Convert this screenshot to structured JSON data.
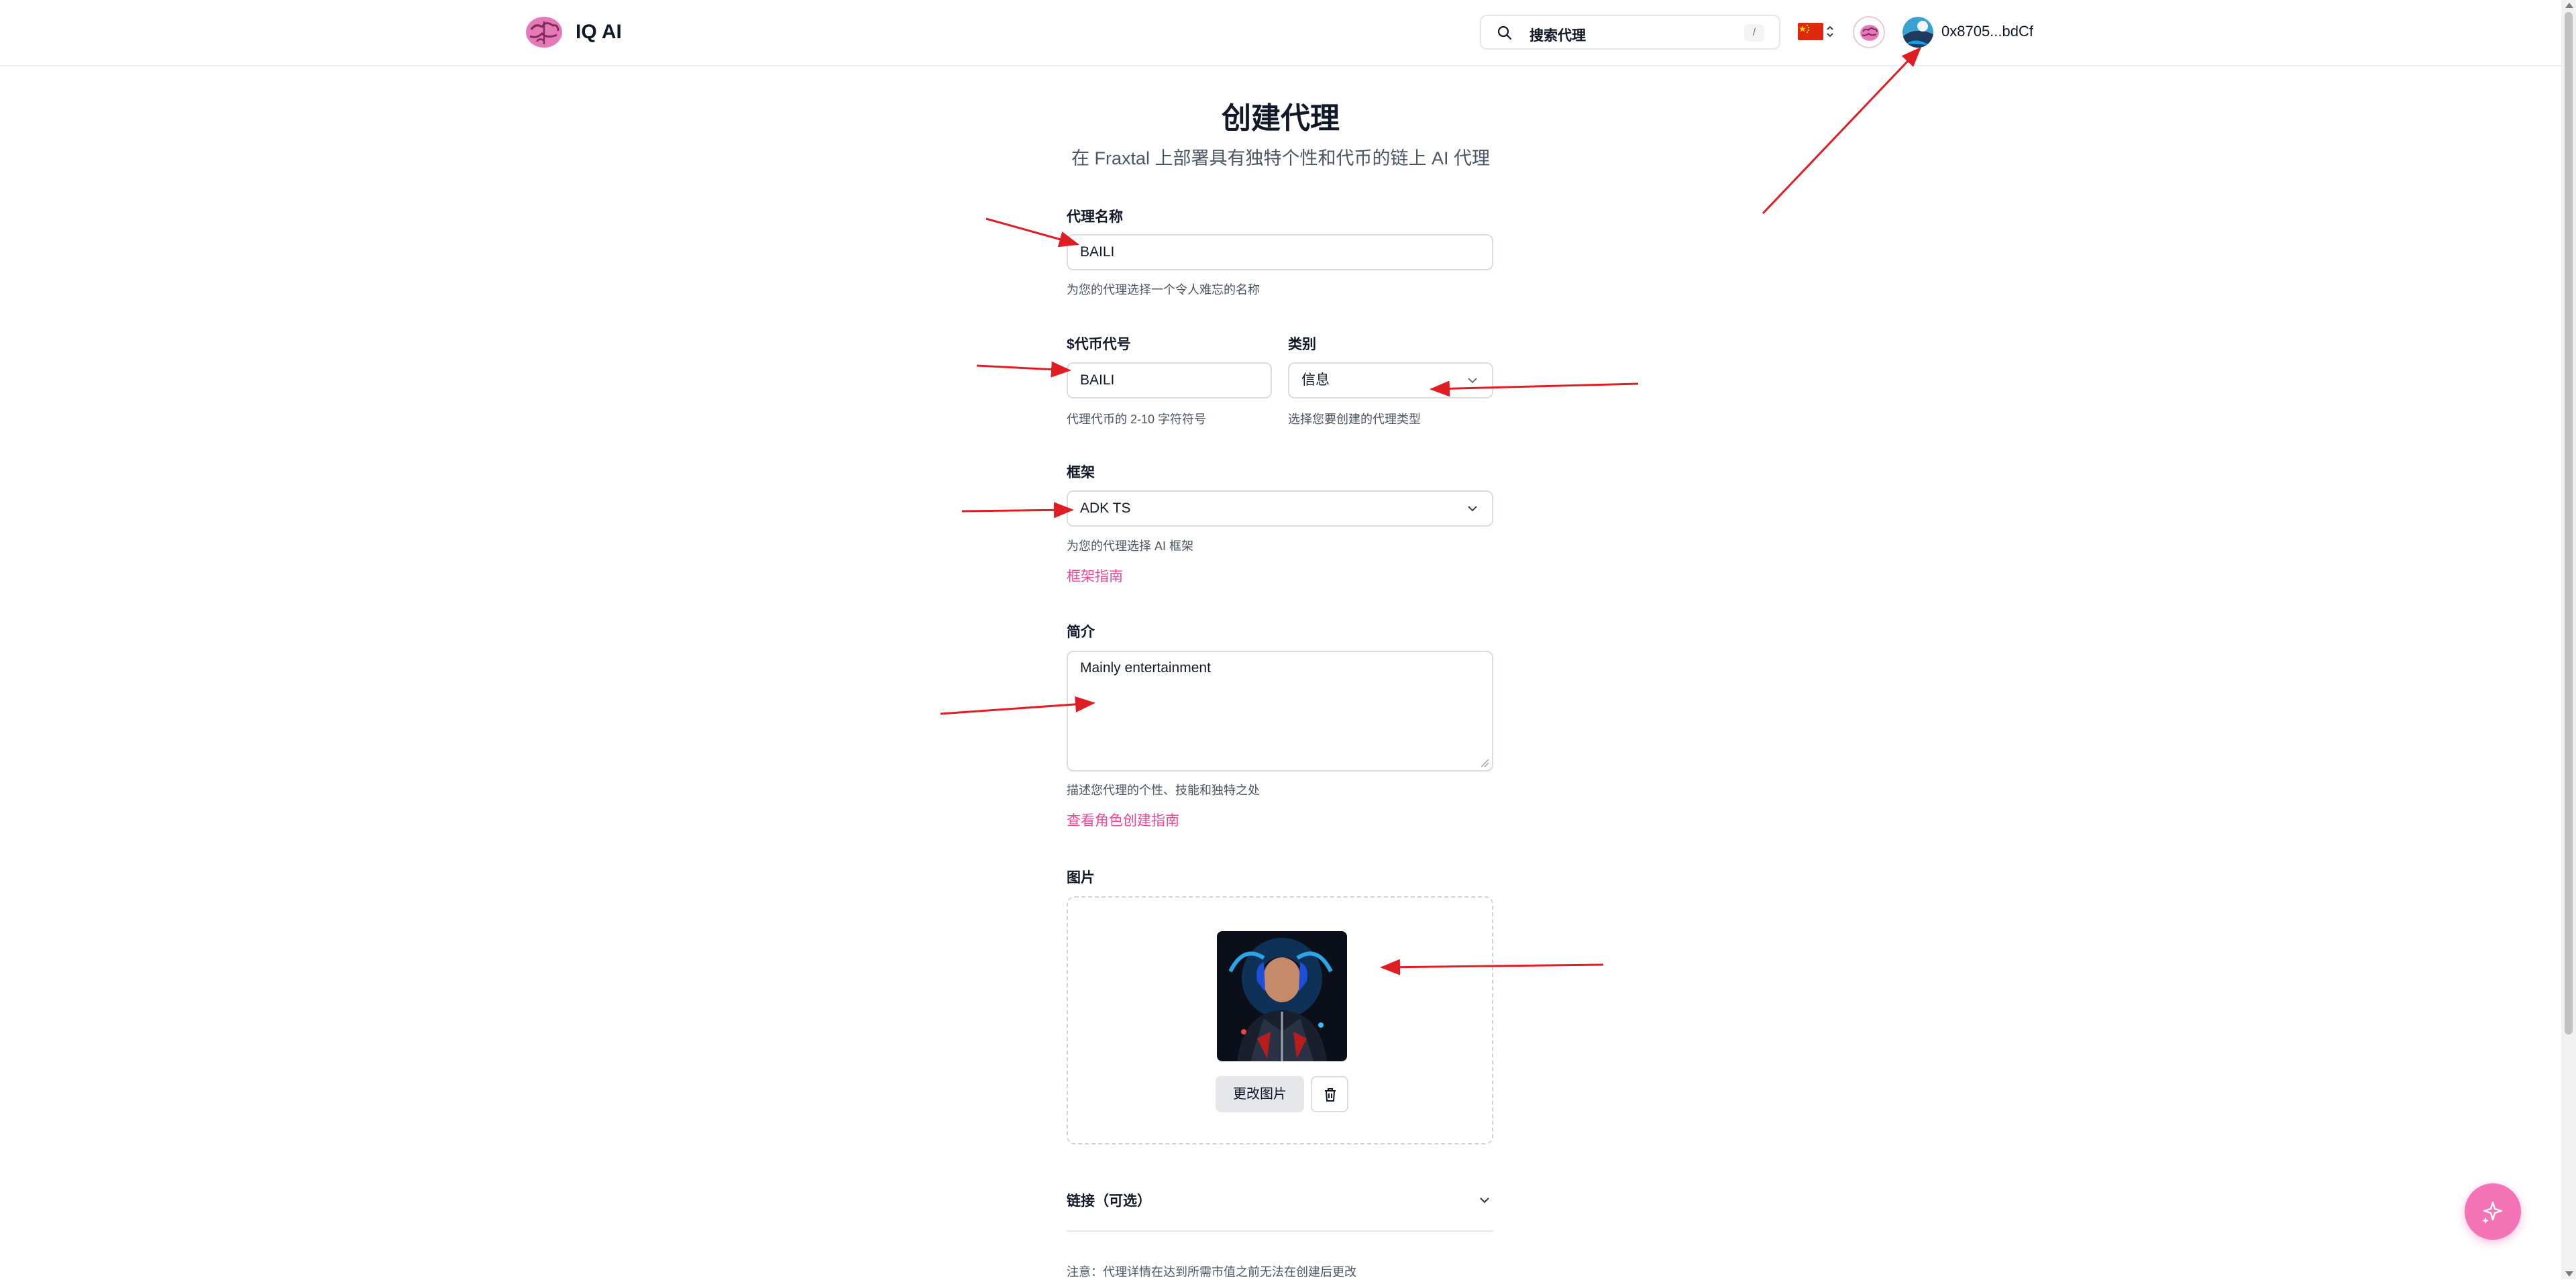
{
  "header": {
    "brand": "IQ AI",
    "search_placeholder": "搜索代理",
    "search_shortcut": "/",
    "language": "CN",
    "wallet_address": "0x8705...bdCf"
  },
  "page": {
    "title": "创建代理",
    "subtitle": "在 Fraxtal 上部署具有独特个性和代币的链上 AI 代理"
  },
  "form": {
    "name": {
      "label": "代理名称",
      "value": "BAILI",
      "help": "为您的代理选择一个令人难忘的名称"
    },
    "ticker": {
      "label": "$代币代号",
      "value": "BAILI",
      "help": "代理代币的 2-10 字符符号"
    },
    "category": {
      "label": "类别",
      "value": "信息",
      "help": "选择您要创建的代理类型"
    },
    "framework": {
      "label": "框架",
      "value": "ADK TS",
      "help": "为您的代理选择 AI 框架",
      "link": "框架指南"
    },
    "bio": {
      "label": "简介",
      "value": "Mainly entertainment",
      "help": "描述您代理的个性、技能和独特之处",
      "link": "查看角色创建指南"
    },
    "image": {
      "label": "图片",
      "change_button": "更改图片"
    },
    "links": {
      "label": "链接（可选）"
    },
    "note": "注意：代理详情在达到所需市值之前无法在创建后更改"
  },
  "colors": {
    "accent": "#ec4899",
    "annotation_arrow": "#e11d24"
  },
  "icons": {
    "logo": "brain-icon",
    "search": "search-icon",
    "flag": "china-flag-icon",
    "fab": "sparkles-icon",
    "delete": "trash-icon"
  }
}
